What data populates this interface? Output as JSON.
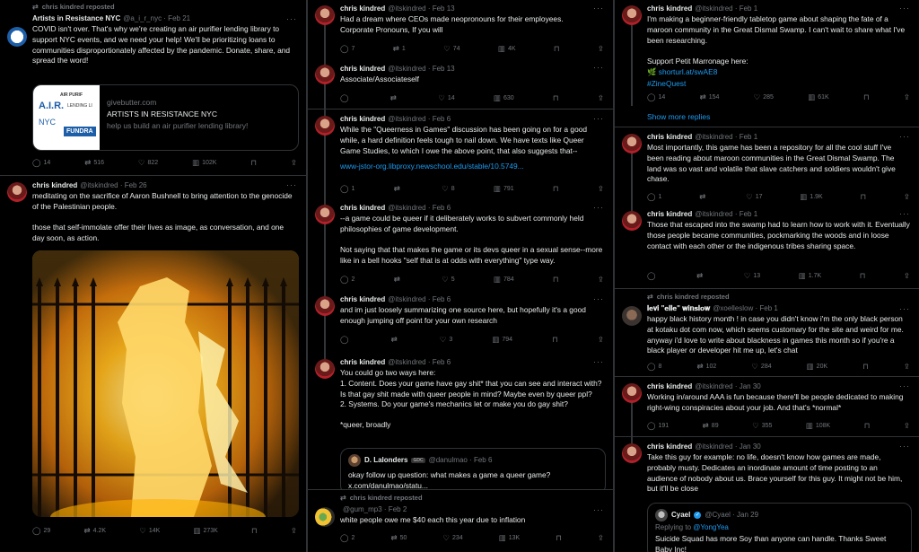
{
  "col1": {
    "t1": {
      "repost": "chris kindred reposted",
      "name": "Artists in Resistance NYC",
      "handle": "@a_i_r_nyc · Feb 21",
      "text": "COVID isn't over. That's why we're creating an air purifier lending library to support NYC events, and we need your help! We'll be prioritizing loans to communities disproportionately affected by the pandemic. Donate, share, and spread the word!",
      "card": {
        "img_a": "A.I.R.",
        "img_b": "NYC",
        "img_c": "AIR PURIF",
        "img_d": "LENDING LI",
        "img_e": "FUNDRA",
        "domain": "givebutter.com",
        "title": "ARTISTS IN RESISTANCE NYC",
        "desc": "help us build an air purifier lending library!"
      },
      "stats": {
        "reply": "14",
        "repost": "516",
        "like": "822",
        "views": "102K"
      }
    },
    "t2": {
      "name": "chris kindred",
      "handle": "@itskindred · Feb 26",
      "text": "meditating on the sacrifice of Aaron Bushnell to bring attention to the genocide of the Palestinian people.\n\nthose that self-immolate offer their lives as image, as conversation, and one day soon, as action.",
      "stats": {
        "reply": "29",
        "repost": "4.2K",
        "like": "14K",
        "views": "273K"
      }
    }
  },
  "col2": {
    "t1": {
      "name": "chris kindred",
      "handle": "@itskindred · Feb 13",
      "text": "Had a dream where CEOs made neopronouns for their employees.\nCorporate Pronouns, If you will",
      "stats": {
        "reply": "7",
        "repost": "1",
        "like": "74",
        "views": "4K"
      }
    },
    "t2": {
      "name": "chris kindred",
      "handle": "@itskindred · Feb 13",
      "text": "Associate/Associateself",
      "stats": {
        "reply": "",
        "repost": "",
        "like": "14",
        "views": "630"
      }
    },
    "t3": {
      "name": "chris kindred",
      "handle": "@itskindred · Feb 6",
      "text": "While the \"Queerness in Games\" discussion has been going on for a good while, a hard definition feels tough to nail down. We have texts like Queer Game Studies, to which I owe the above point, that also suggests that--",
      "link": "www-jstor-org.libproxy.newschool.edu/stable/10.5749...",
      "stats": {
        "reply": "1",
        "repost": "",
        "like": "8",
        "views": "791"
      }
    },
    "t4": {
      "name": "chris kindred",
      "handle": "@itskindred · Feb 6",
      "text": "--a game could be queer if it deliberately works to subvert commonly held philosophies of game development.\n\nNot saying that that makes the game or its devs queer in a sexual sense--more like in a bell hooks \"self that is at odds with everything\" type way.",
      "stats": {
        "reply": "2",
        "repost": "",
        "like": "5",
        "views": "784"
      }
    },
    "t5": {
      "name": "chris kindred",
      "handle": "@itskindred · Feb 6",
      "text": "and im just loosely summarizing one source here, but hopefully it's a good enough jumping off point for your own research",
      "stats": {
        "reply": "",
        "repost": "",
        "like": "3",
        "views": "794"
      }
    },
    "t6": {
      "name": "chris kindred",
      "handle": "@itskindred · Feb 6",
      "text": "You could go two ways here:\n1. Content. Does your game have gay shit* that you can see and interact with? Is that gay shit made with queer people in mind? Maybe even by queer ppl?\n2. Systems. Do your game's mechanics let or make you do gay shit?\n\n*queer, broadly",
      "quote": {
        "name": "D. Lalonders",
        "badge": "GDC",
        "handle": "@danulmao · Feb 6",
        "text": "okay follow up question: what makes a game a queer game?\nx.com/danulmao/statu..."
      }
    },
    "t7": {
      "repost": "chris kindred reposted",
      "name": "",
      "handle": "@gum_mp3 · Feb 2",
      "text": "white people owe me $40 each this year due to inflation",
      "stats": {
        "reply": "2",
        "repost": "50",
        "like": "234",
        "views": "13K"
      }
    }
  },
  "col3": {
    "t1": {
      "name": "chris kindred",
      "handle": "@itskindred · Feb 1",
      "text": "I'm making a beginner-friendly tabletop game about shaping the fate of a maroon community in the Great Dismal Swamp. I can't wait to share what I've been researching.\n\nSupport Petit Marronage here:",
      "link1": "🌿 shorturl.at/swAE8",
      "link2": "#ZineQuest",
      "stats": {
        "reply": "14",
        "repost": "154",
        "like": "285",
        "views": "61K"
      }
    },
    "show_more": "Show more replies",
    "t2": {
      "name": "chris kindred",
      "handle": "@itskindred · Feb 1",
      "text": "Most importantly, this game has been a repository for all the cool stuff I've been reading about maroon communities in the Great Dismal Swamp. The land was so vast and volatile that slave catchers and soldiers wouldn't give chase.",
      "stats": {
        "reply": "1",
        "repost": "",
        "like": "17",
        "views": "1.9K"
      }
    },
    "t3": {
      "name": "chris kindred",
      "handle": "@itskindred · Feb 1",
      "text": "Those that escaped into the swamp had to learn how to work with it. Eventually those people became communities, pockmarking the woods and in loose contact with each other or the indigenous tribes sharing space.",
      "stats": {
        "reply": "",
        "repost": "",
        "like": "13",
        "views": "1.7K"
      }
    },
    "t4": {
      "repost": "chris kindred reposted",
      "name": "𝐥𝐞𝐯𝐢 \"𝐞𝐥𝐥𝐞\" 𝐰𝐢𝐧𝐬𝐥𝐨𝐰",
      "handle": "@xoelleslow · Feb 1",
      "text": "happy black history month ! in case you didn't know i'm the only black person at kotaku dot com now, which seems customary for the site and weird for me. anyway i'd love to write about blackness in games this month so if you're a black player or developer hit me up, let's chat",
      "stats": {
        "reply": "8",
        "repost": "102",
        "like": "284",
        "views": "20K"
      }
    },
    "t5": {
      "name": "chris kindred",
      "handle": "@itskindred · Jan 30",
      "text": "Working in/around AAA is fun because there'll be people dedicated to making right-wing conspiracies about your job. And that's *normal*",
      "stats": {
        "reply": "191",
        "repost": "89",
        "like": "355",
        "views": "108K"
      }
    },
    "t6": {
      "name": "chris kindred",
      "handle": "@itskindred · Jan 30",
      "text": "Take this guy for example: no life, doesn't know how games are made, probably musty. Dedicates an inordinate amount of time posting to an audience of nobody about us. Brace yourself for this guy. It might not be him, but it'll be close",
      "quote": {
        "name": "Cyael",
        "handle": "@Cyael · Jan 29",
        "replying_pre": "Replying to",
        "replying_user": "@YongYea",
        "text": "Suicide Squad has more Soy than anyone can handle. Thanks Sweet Baby Inc!"
      }
    }
  },
  "icons": {
    "reply": "reply-icon",
    "repost": "repost-icon",
    "like": "like-icon",
    "views": "views-icon",
    "bookmark": "bookmark-icon",
    "share": "share-icon",
    "more": "more-icon"
  },
  "colors": {
    "bg": "#000000",
    "text": "#e7e9ea",
    "muted": "#71767b",
    "link": "#1d9bf0",
    "border": "#2f3336"
  }
}
